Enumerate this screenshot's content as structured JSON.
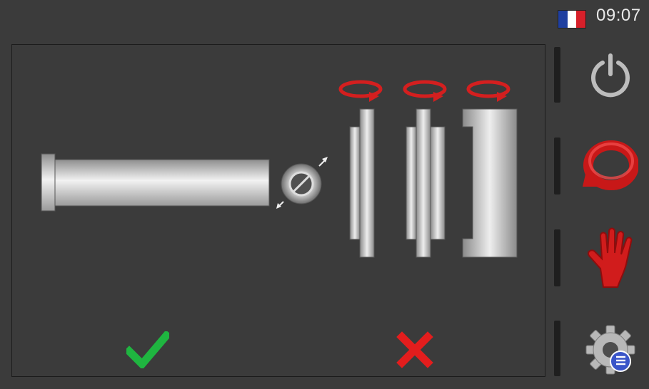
{
  "status": {
    "time": "09:07",
    "flag_colors": [
      "#1f3fa0",
      "#ffffff",
      "#d7202a"
    ]
  },
  "machine": {
    "tool_count": 3,
    "rotation_icon_color": "#d41f1f",
    "diameter_symbol": "⌀"
  },
  "sidebar": {
    "items": [
      {
        "name": "power",
        "icon": "power-icon"
      },
      {
        "name": "rotation",
        "icon": "rotate-icon"
      },
      {
        "name": "manual",
        "icon": "hand-icon"
      },
      {
        "name": "settings",
        "icon": "settings-list-icon"
      }
    ]
  },
  "actions": {
    "confirm_icon": "check-icon",
    "confirm_color": "#1fb540",
    "cancel_icon": "cross-icon",
    "cancel_color": "#e31d1d"
  }
}
